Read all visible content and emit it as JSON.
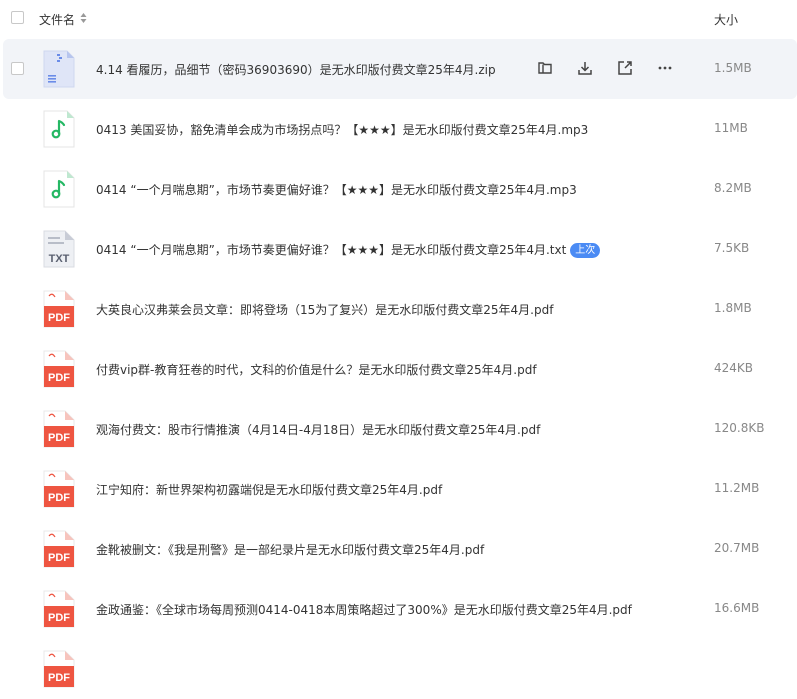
{
  "header": {
    "name_label": "文件名",
    "size_label": "大小"
  },
  "files": [
    {
      "type": "zip",
      "name": "4.14 看履历，品细节（密码36903690）是无水印版付费文章25年4月.zip",
      "size": "1.5MB",
      "hover": true
    },
    {
      "type": "mp3",
      "name": "0413 美国妥协，豁免清单会成为市场拐点吗？【★★★】是无水印版付费文章25年4月.mp3",
      "size": "11MB"
    },
    {
      "type": "mp3",
      "name": "0414 “一个月喘息期”，市场节奏更偏好谁？【★★★】是无水印版付费文章25年4月.mp3",
      "size": "8.2MB"
    },
    {
      "type": "txt",
      "name": "0414 “一个月喘息期”，市场节奏更偏好谁？【★★★】是无水印版付费文章25年4月.txt",
      "size": "7.5KB",
      "badge": "上次"
    },
    {
      "type": "pdf",
      "name": "大英良心汉弗莱会员文章：即将登场（15为了复兴）是无水印版付费文章25年4月.pdf",
      "size": "1.8MB"
    },
    {
      "type": "pdf",
      "name": "付费vip群-教育狂卷的时代，文科的价值是什么？是无水印版付费文章25年4月.pdf",
      "size": "424KB"
    },
    {
      "type": "pdf",
      "name": "观海付费文：股市行情推演（4月14日-4月18日）是无水印版付费文章25年4月.pdf",
      "size": "120.8KB"
    },
    {
      "type": "pdf",
      "name": "江宁知府：新世界架构初露端倪是无水印版付费文章25年4月.pdf",
      "size": "11.2MB"
    },
    {
      "type": "pdf",
      "name": "金靴被删文：《我是刑警》是一部纪录片是无水印版付费文章25年4月.pdf",
      "size": "20.7MB"
    },
    {
      "type": "pdf",
      "name": "金政通鉴：《全球市场每周预测0414-0418本周策略超过了300%》是无水印版付费文章25年4月.pdf",
      "size": "16.6MB"
    },
    {
      "type": "pdf",
      "name": "",
      "size": ""
    }
  ],
  "icon_labels": {
    "pdf": "PDF",
    "txt": "TXT"
  },
  "colors": {
    "pdf": "#ee5541",
    "mp3": "#25b864",
    "zip": "#6b8ce8",
    "accent": "#4b8bf4"
  }
}
